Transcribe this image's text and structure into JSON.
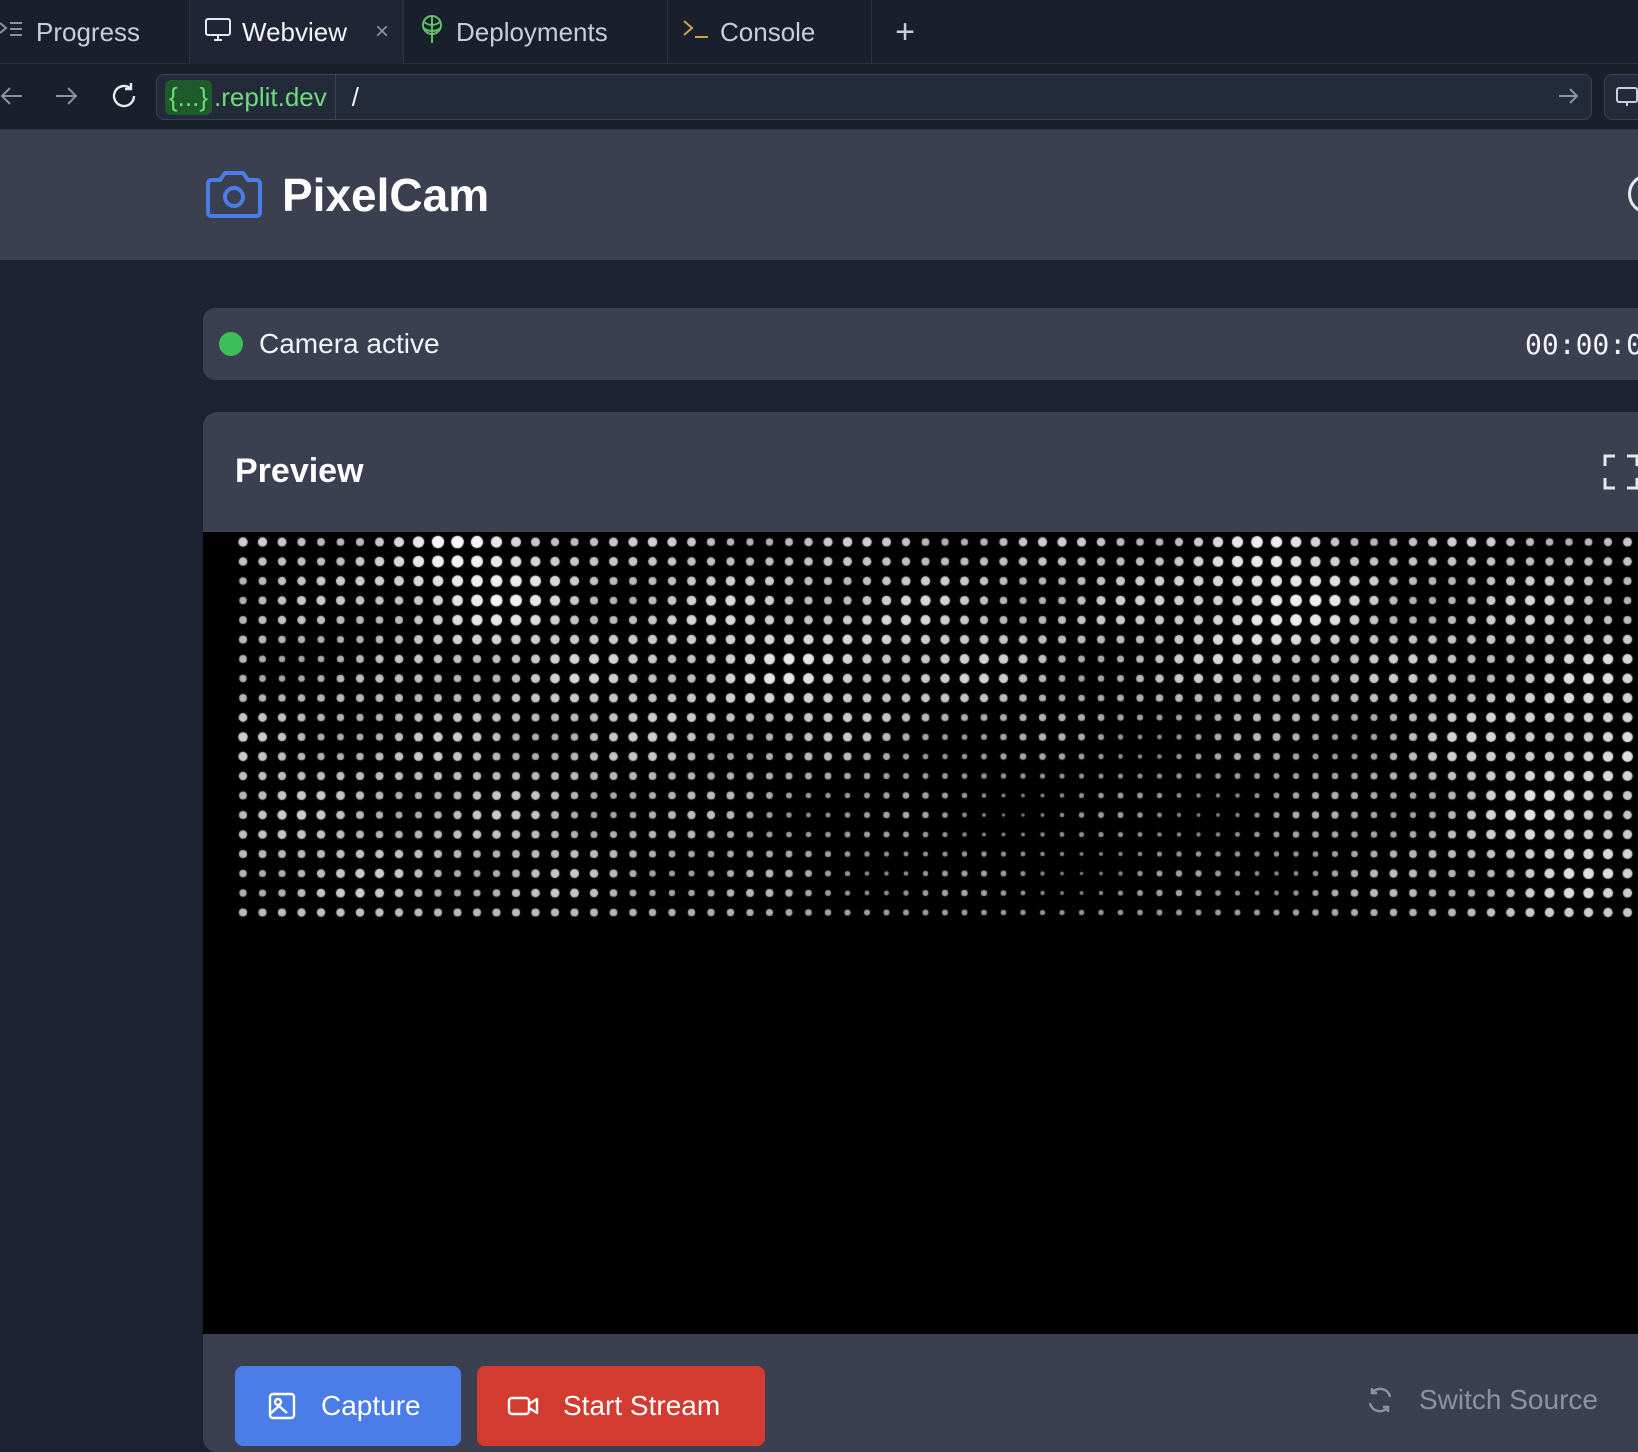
{
  "tabs": [
    {
      "label": "Progress"
    },
    {
      "label": "Webview"
    },
    {
      "label": "Deployments"
    },
    {
      "label": "Console"
    }
  ],
  "tab_close": "×",
  "tab_add": "+",
  "url": {
    "host_badge": "{...}",
    "host_suffix": ".replit.dev",
    "path": "/"
  },
  "app": {
    "title": "PixelCam"
  },
  "status": {
    "text": "Camera active",
    "timer": "00:00:0"
  },
  "preview": {
    "title": "Preview"
  },
  "controls": {
    "capture": "Capture",
    "start_stream": "Start Stream",
    "switch_source": "Switch Source"
  },
  "colors": {
    "accent": "#4a7de8",
    "danger": "#d33b30",
    "active": "#3cc05a",
    "host": "#6fdc7a"
  }
}
